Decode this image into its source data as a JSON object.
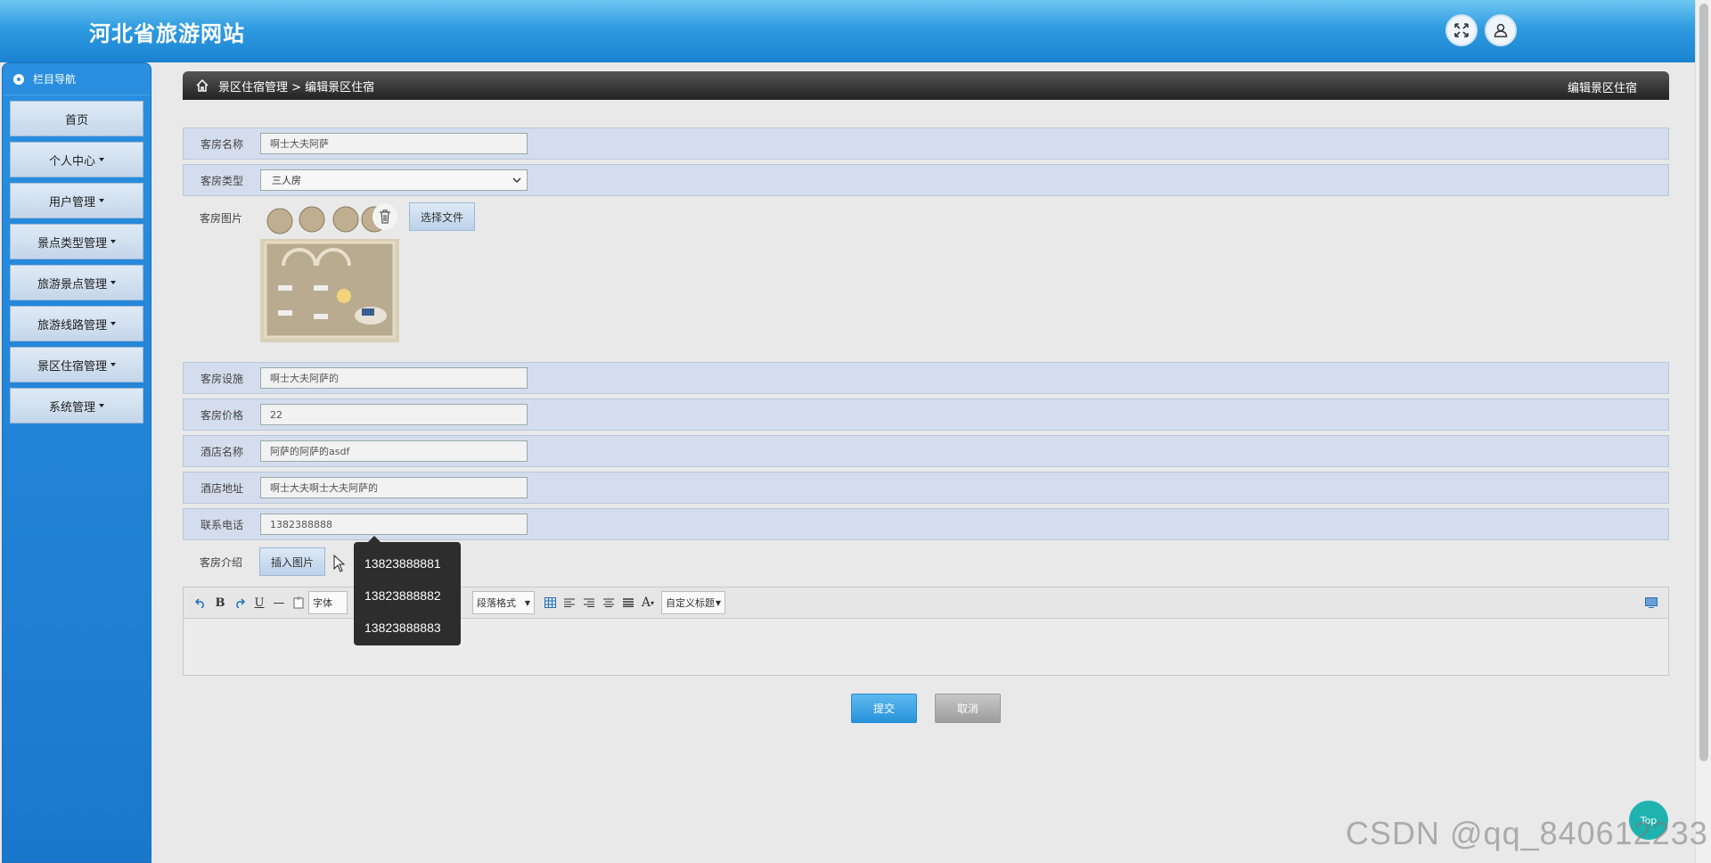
{
  "header": {
    "site_title": "河北省旅游网站"
  },
  "sidebar": {
    "heading": "栏目导航",
    "items": [
      {
        "label": "首页",
        "has_caret": false
      },
      {
        "label": "个人中心",
        "has_caret": true
      },
      {
        "label": "用户管理",
        "has_caret": true
      },
      {
        "label": "景点类型管理",
        "has_caret": true
      },
      {
        "label": "旅游景点管理",
        "has_caret": true
      },
      {
        "label": "旅游线路管理",
        "has_caret": true
      },
      {
        "label": "景区住宿管理",
        "has_caret": true
      },
      {
        "label": "系统管理",
        "has_caret": true
      }
    ]
  },
  "breadcrumb": {
    "path": "景区住宿管理 > 编辑景区住宿",
    "right_title": "编辑景区住宿"
  },
  "form": {
    "room_name": {
      "label": "客房名称",
      "value": "啊士大夫阿萨"
    },
    "room_type": {
      "label": "客房类型",
      "value": "三人房"
    },
    "room_image": {
      "label": "客房图片",
      "choose_file": "选择文件"
    },
    "facilities": {
      "label": "客房设施",
      "value": "啊士大夫阿萨的"
    },
    "price": {
      "label": "客房价格",
      "value": "22"
    },
    "hotel_name": {
      "label": "酒店名称",
      "value": "阿萨的阿萨的asdf"
    },
    "hotel_address": {
      "label": "酒店地址",
      "value": "啊士大夫啊士大夫阿萨的"
    },
    "phone": {
      "label": "联系电话",
      "value": "1382388888"
    },
    "intro": {
      "label": "客房介绍",
      "insert_image": "插入图片"
    }
  },
  "editor_toolbar": {
    "font": "字体",
    "paragraph": "段落格式",
    "custom_title": "自定义标题"
  },
  "autocomplete": [
    "13823888881",
    "13823888882",
    "13823888883"
  ],
  "actions": {
    "submit": "提交",
    "cancel": "取消"
  },
  "top_button": "Top",
  "watermark": "CSDN @qq_840612233",
  "colors": {
    "header_blue": "#1a83d1",
    "sidebar_blue": "#1a78cc",
    "submit_blue": "#2793da",
    "top_teal": "#1fb3b0"
  }
}
